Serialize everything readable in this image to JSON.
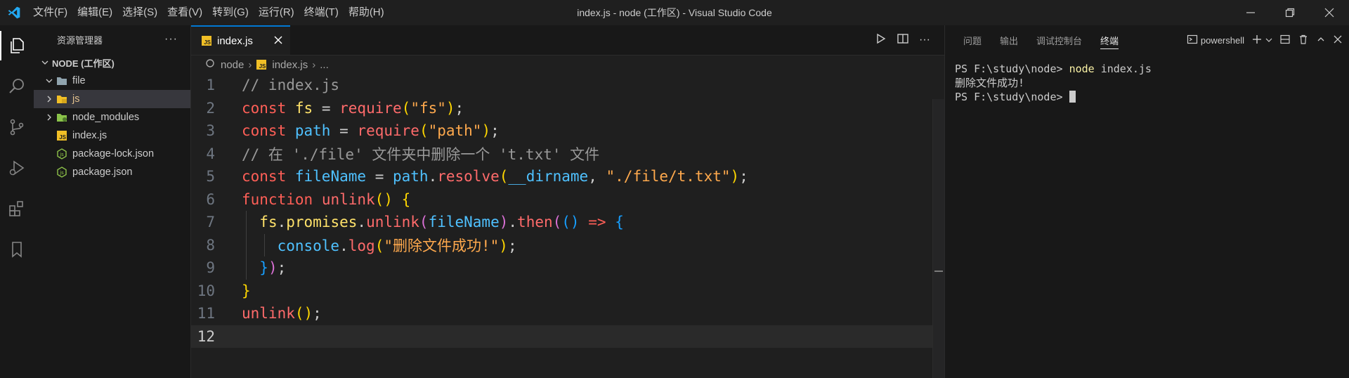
{
  "window": {
    "title": "index.js - node (工作区) - Visual Studio Code",
    "menu": [
      "文件(F)",
      "编辑(E)",
      "选择(S)",
      "查看(V)",
      "转到(G)",
      "运行(R)",
      "终端(T)",
      "帮助(H)"
    ]
  },
  "sidebar": {
    "title": "资源管理器",
    "section": "NODE (工作区)",
    "items": [
      {
        "label": "file",
        "type": "folder",
        "expanded": true
      },
      {
        "label": "js",
        "type": "folder",
        "expanded": false
      },
      {
        "label": "node_modules",
        "type": "folder",
        "expanded": false
      },
      {
        "label": "index.js",
        "type": "js-file"
      },
      {
        "label": "package-lock.json",
        "type": "json-file"
      },
      {
        "label": "package.json",
        "type": "json-file"
      }
    ]
  },
  "editor": {
    "tab": "index.js",
    "breadcrumb": [
      "node",
      "index.js",
      "..."
    ],
    "lines": [
      "// index.js",
      "const fs = require(\"fs\");",
      "const path = require(\"path\");",
      "// 在 './file' 文件夹中删除一个 't.txt' 文件",
      "const fileName = path.resolve(__dirname, \"./file/t.txt\");",
      "function unlink() {",
      "  fs.promises.unlink(fileName).then(() => {",
      "    console.log(\"删除文件成功!\");",
      "  });",
      "}",
      "unlink();",
      ""
    ],
    "line_numbers": [
      "1",
      "2",
      "3",
      "4",
      "5",
      "6",
      "7",
      "8",
      "9",
      "10",
      "11",
      "12"
    ],
    "current_line": 12
  },
  "panel": {
    "tabs": [
      "问题",
      "输出",
      "调试控制台",
      "终端"
    ],
    "active_tab": "终端",
    "shell": "powershell",
    "terminal": {
      "prompt1": "PS F:\\study\\node> ",
      "command": "node",
      "args": " index.js",
      "output": "删除文件成功!",
      "prompt2": "PS F:\\study\\node> "
    }
  },
  "colors": {
    "accent": "#0078d4",
    "js_icon": "#f1bf26",
    "json_icon": "#8dc149"
  }
}
